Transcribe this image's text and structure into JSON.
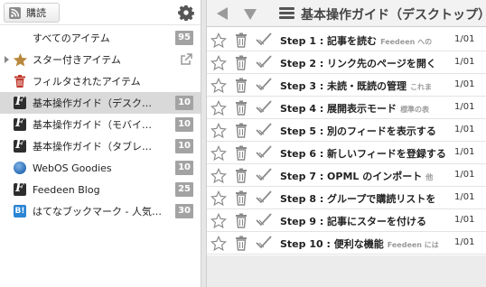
{
  "sidebar": {
    "subscribe_label": "購読",
    "items": [
      {
        "label": "すべてのアイテム",
        "count": "95"
      },
      {
        "label": "スター付きアイテム"
      },
      {
        "label": "フィルタされたアイテム"
      },
      {
        "label": "基本操作ガイド（デスク…",
        "count": "10"
      },
      {
        "label": "基本操作ガイド（モバイ…",
        "count": "10"
      },
      {
        "label": "基本操作ガイド（タブレ…",
        "count": "10"
      },
      {
        "label": "WebOS Goodies",
        "count": "10"
      },
      {
        "label": "Feedeen Blog",
        "count": "25"
      },
      {
        "label": "はてなブックマーク - 人気…",
        "count": "30"
      }
    ]
  },
  "main": {
    "feed_title": "基本操作ガイド（デスクトップ）",
    "entries": [
      {
        "title": "Step 1 : 記事を読む",
        "snippet": "Feedeen への",
        "date": "1/01"
      },
      {
        "title": "Step 2 : リンク先のページを開く",
        "snippet": "",
        "date": "1/01"
      },
      {
        "title": "Step 3 : 未読・既読の管理",
        "snippet": "これま",
        "date": "1/01"
      },
      {
        "title": "Step 4 : 展開表示モード",
        "snippet": "標準の表",
        "date": "1/01"
      },
      {
        "title": "Step 5 : 別のフィードを表示する",
        "snippet": "",
        "date": "1/01"
      },
      {
        "title": "Step 6 : 新しいフィードを登録する",
        "snippet": "",
        "date": "1/01"
      },
      {
        "title": "Step 7 : OPML のインポート",
        "snippet": "他",
        "date": "1/01"
      },
      {
        "title": "Step 8 : グループで購読リストを",
        "snippet": "",
        "date": "1/01"
      },
      {
        "title": "Step 9 : 記事にスターを付ける",
        "snippet": "",
        "date": "1/01"
      },
      {
        "title": "Step 10 : 便利な機能",
        "snippet": "Feedeen には",
        "date": "1/01"
      }
    ]
  },
  "colors": {
    "count_badge": "#a3a3a3",
    "selected_row": "#d9d9d9",
    "star_fav": "#b8893e",
    "filter_fav": "#c0392b"
  }
}
